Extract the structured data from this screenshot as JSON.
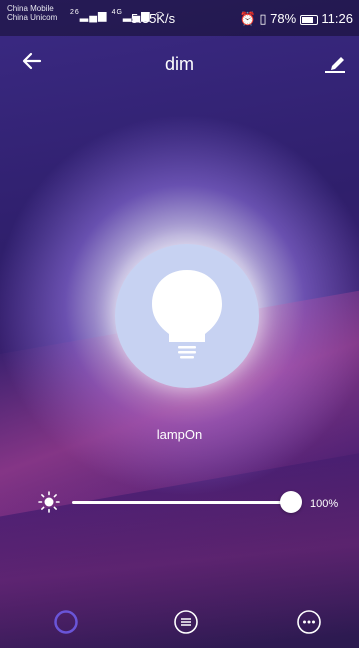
{
  "status_bar": {
    "carrier_1": "China Mobile",
    "carrier_2": "China Unicom",
    "signal_1": "26",
    "signal_2": "4G",
    "net_speed": "5.35K/s",
    "battery": "78%",
    "time": "11:26"
  },
  "header": {
    "title": "dim",
    "back_icon": "back-arrow-icon",
    "edit_icon": "pencil-icon"
  },
  "lamp": {
    "label": "lampOn",
    "icon": "light-bulb-icon"
  },
  "brightness": {
    "value_percent": 100,
    "label": "100%",
    "icon": "sun-icon"
  },
  "bottom_nav": {
    "items": [
      {
        "icon": "ring-icon",
        "active": true
      },
      {
        "icon": "list-icon",
        "active": false
      },
      {
        "icon": "more-icon",
        "active": false
      }
    ]
  },
  "colors": {
    "accent": "#6a55d8",
    "lamp_circle": "#c7d2f2",
    "text": "#ffffff"
  }
}
